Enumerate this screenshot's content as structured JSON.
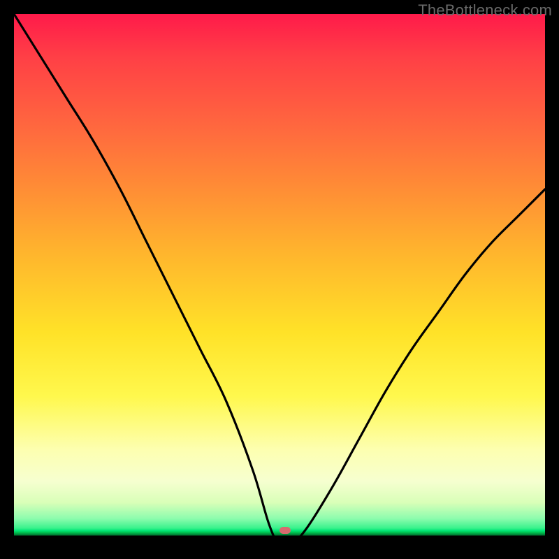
{
  "watermark": "TheBottleneck.com",
  "colors": {
    "background": "#000000",
    "curve_stroke": "#000000",
    "marker": "#d86b6f",
    "gradient_stops": [
      "#ff1a4a",
      "#ff6a3e",
      "#ffb52d",
      "#ffe228",
      "#fdffb0",
      "#8dfcae",
      "#00e676",
      "#006d2e",
      "#000000"
    ]
  },
  "chart_data": {
    "type": "line",
    "title": "",
    "xlabel": "",
    "ylabel": "",
    "xlim": [
      0,
      100
    ],
    "ylim": [
      0,
      100
    ],
    "note": "No axes, ticks, or numeric labels are visible. Values below are estimates read from the curve's position relative to the plot rectangle (0 = left/bottom, 100 = right/top).",
    "series": [
      {
        "name": "curve",
        "x": [
          0,
          5,
          10,
          15,
          20,
          25,
          30,
          35,
          40,
          45,
          48,
          50,
          52,
          55,
          60,
          65,
          70,
          75,
          80,
          85,
          90,
          95,
          100
        ],
        "y": [
          100,
          92,
          84,
          76,
          67,
          57,
          47,
          37,
          27,
          14,
          4,
          0,
          0,
          3,
          11,
          20,
          29,
          37,
          44,
          51,
          57,
          62,
          67
        ]
      }
    ],
    "marker": {
      "x": 51,
      "y": 0,
      "shape": "rounded-rect",
      "color": "#d86b6f"
    }
  }
}
